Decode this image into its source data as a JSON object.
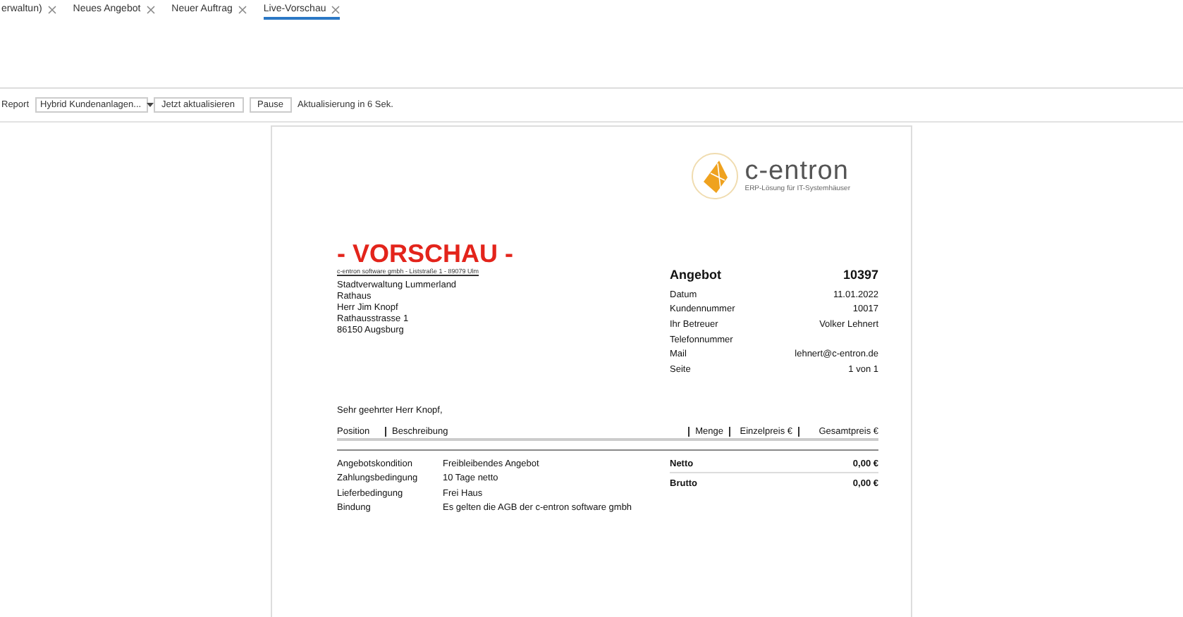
{
  "tabs": [
    {
      "label": "erwaltun)",
      "selected": false
    },
    {
      "label": "Neues Angebot",
      "selected": false
    },
    {
      "label": "Neuer Auftrag",
      "selected": false
    },
    {
      "label": "Live-Vorschau",
      "selected": true
    }
  ],
  "toolbar": {
    "report_label": "Report",
    "report_value": "Hybrid Kundenanlagen...",
    "buttons": [
      "Jetzt aktualisieren",
      "Pause"
    ],
    "status": "Aktualisierung in 6 Sek."
  },
  "document": {
    "logo": {
      "name": "c-entron",
      "tagline": "ERP-Lösung für IT-Systemhäuser"
    },
    "watermark": "- VORSCHAU -",
    "sender_line": "c-entron software gmbh - Liststraße 1 - 89079 Ulm",
    "address": [
      "Stadtverwaltung Lummerland",
      "Rathaus",
      "Herr Jim Knopf",
      "Rathausstrasse 1",
      "86150 Augsburg"
    ],
    "title": "Angebot",
    "number": "10397",
    "info": [
      {
        "label": "Datum",
        "value": "11.01.2022"
      },
      {
        "label": "Kundennummer",
        "value": "10017"
      },
      {
        "label": "Ihr Betreuer",
        "value": "Volker Lehnert"
      },
      {
        "label": "Telefonnummer"
      },
      {
        "label": "Mail",
        "value": "lehnert@c-entron.de"
      },
      {
        "label": "Seite",
        "value": "1 von 1"
      }
    ],
    "greeting": "Sehr geehrter Herr Knopf,",
    "columns": [
      "Position",
      "Beschreibung",
      "Menge",
      "Einzelpreis €",
      "Gesamtpreis €"
    ],
    "conditions": [
      {
        "label": "Angebotskondition",
        "value": "Freibleibendes Angebot"
      },
      {
        "label": "Zahlungsbedingung",
        "value": "10 Tage netto"
      },
      {
        "label": "Lieferbedingung",
        "value": "Frei Haus"
      },
      {
        "label": "Bindung",
        "value": "Es gelten die AGB der c-entron software gmbh"
      }
    ],
    "totals": [
      {
        "label": "Netto",
        "value": "0,00 €"
      },
      {
        "label": "Brutto",
        "value": "0,00 €"
      }
    ]
  }
}
